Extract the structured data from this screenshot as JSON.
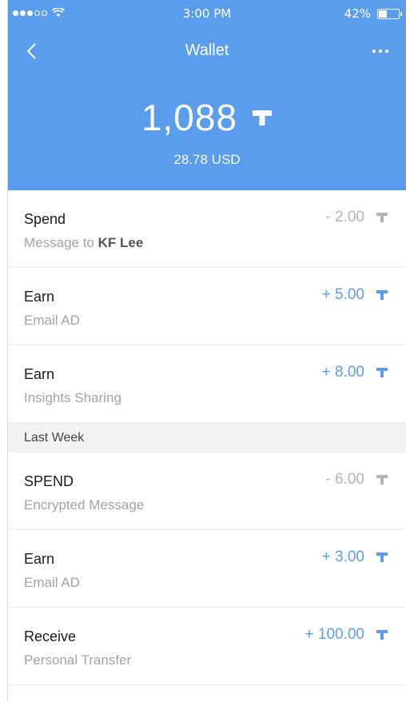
{
  "status": {
    "time": "3:00 PM",
    "battery": "42%"
  },
  "header": {
    "title": "Wallet",
    "balance": "1,088",
    "usd": "28.78 USD"
  },
  "transactions": [
    {
      "type": "Spend",
      "desc_prefix": "Message to ",
      "desc_bold": "KF Lee",
      "amount": "- 2.00",
      "direction": "negative"
    },
    {
      "type": "Earn",
      "desc": "Email AD",
      "amount": "+ 5.00",
      "direction": "positive"
    },
    {
      "type": "Earn",
      "desc": "Insights Sharing",
      "amount": "+ 8.00",
      "direction": "positive"
    }
  ],
  "section_last_week": "Last Week",
  "last_week": [
    {
      "type": "SPEND",
      "desc": "Encrypted Message",
      "amount": "- 6.00",
      "direction": "negative"
    },
    {
      "type": "Earn",
      "desc": "Email AD",
      "amount": "+ 3.00",
      "direction": "positive"
    },
    {
      "type": "Receive",
      "desc": "Personal Transfer",
      "amount": "+ 100.00",
      "direction": "positive"
    }
  ],
  "icons": {
    "back": "chevron-left-icon",
    "more": "more-horizontal-icon",
    "token": "token-t-icon"
  },
  "colors": {
    "accent": "#5b9ded",
    "negative": "#b3b3b3"
  }
}
